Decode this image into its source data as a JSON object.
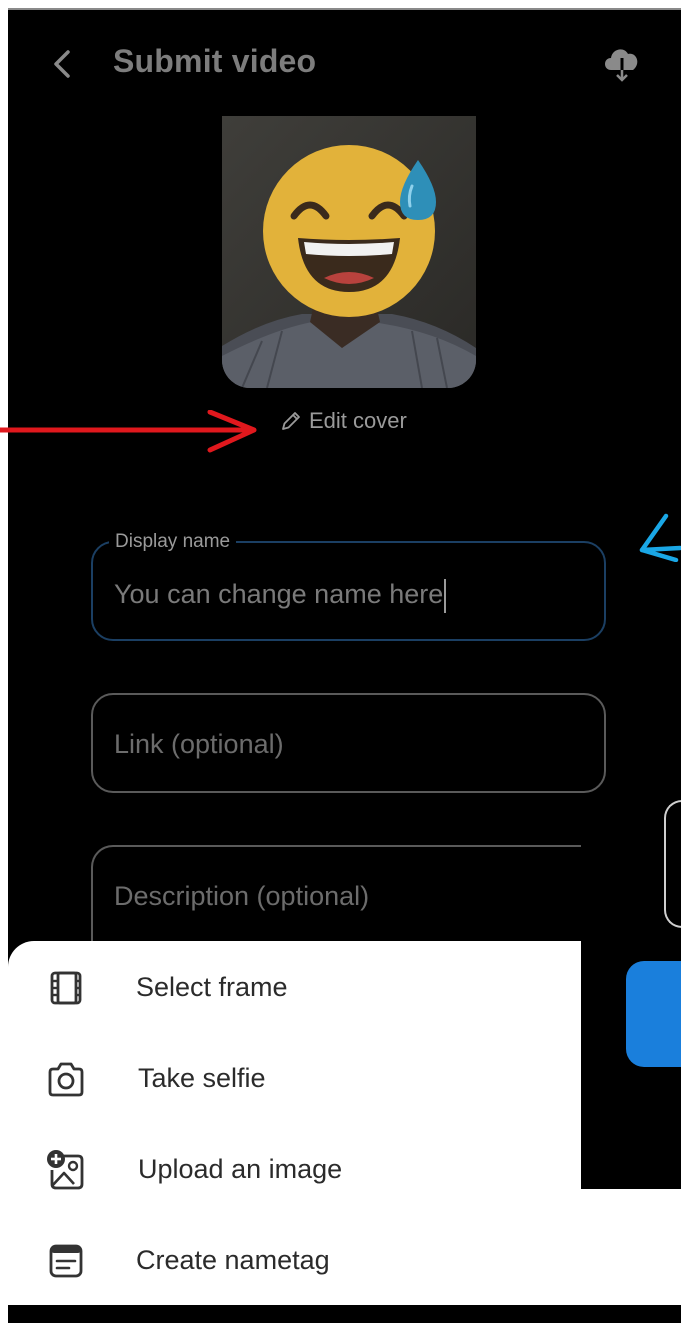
{
  "header": {
    "title": "Submit video",
    "back_icon": "chevron-left-icon",
    "download_icon": "cloud-download-icon"
  },
  "cover": {
    "edit_label": "Edit cover",
    "edit_icon": "pencil-icon"
  },
  "form": {
    "display_name": {
      "legend": "Display name",
      "value": "You can change name here"
    },
    "link": {
      "placeholder": "Link (optional)"
    },
    "description": {
      "placeholder": "Description (optional)"
    }
  },
  "menu": {
    "items": [
      {
        "label": "Select frame",
        "icon": "film-icon"
      },
      {
        "label": "Take selfie",
        "icon": "camera-icon"
      },
      {
        "label": "Upload an image",
        "icon": "add-image-icon"
      },
      {
        "label": "Create nametag",
        "icon": "nametag-icon"
      }
    ]
  },
  "colors": {
    "background": "#000000",
    "sheet": "#ffffff",
    "accent_blue": "#1a7fdc",
    "annotation_red": "#e0181d",
    "annotation_blue": "#1aa7e6"
  }
}
